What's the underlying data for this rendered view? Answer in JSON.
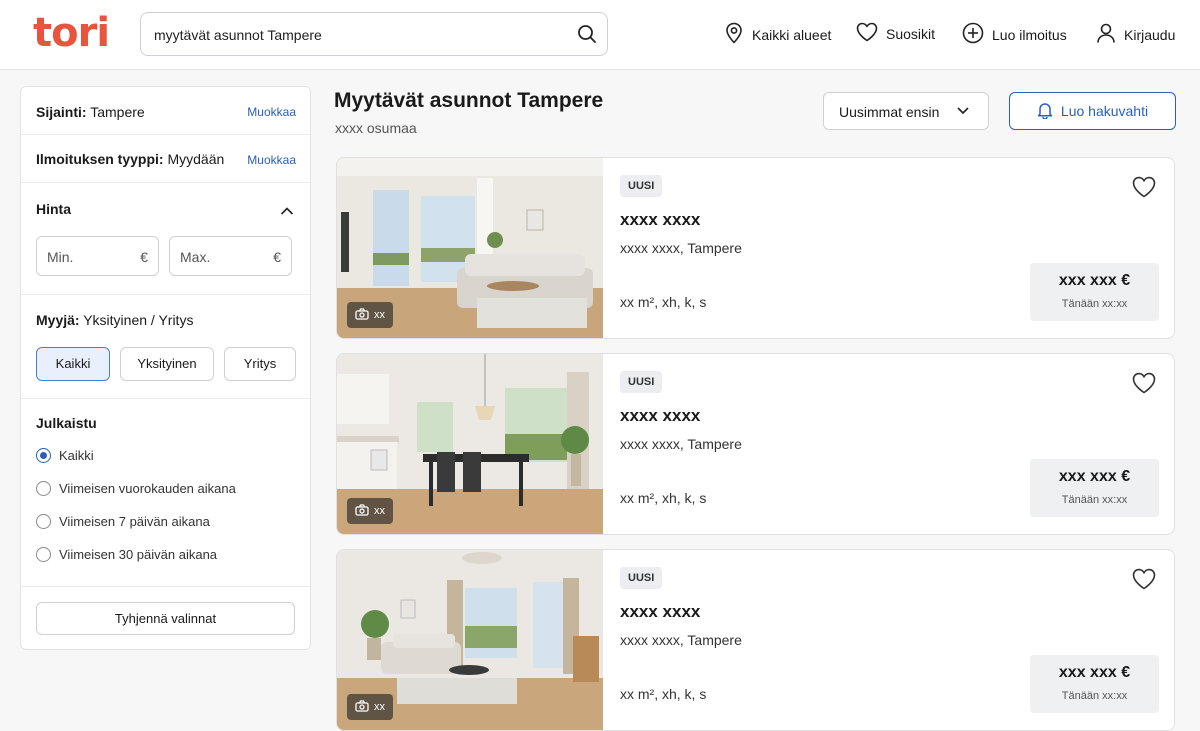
{
  "header": {
    "logo": "tori",
    "search_value": "myytävät asunnot Tampere",
    "nav": [
      {
        "label": "Kaikki alueet",
        "icon": "location-pin-icon"
      },
      {
        "label": "Suosikit",
        "icon": "heart-icon"
      },
      {
        "label": "Luo ilmoitus",
        "icon": "plus-circle-icon"
      },
      {
        "label": "Kirjaudu",
        "icon": "user-icon"
      }
    ]
  },
  "sidebar": {
    "location": {
      "label": "Sijainti:",
      "value": "Tampere",
      "edit": "Muokkaa"
    },
    "type": {
      "label": "Ilmoituksen tyyppi:",
      "value": "Myydään",
      "edit": "Muokkaa"
    },
    "price": {
      "label": "Hinta",
      "min_placeholder": "Min.",
      "max_placeholder": "Max.",
      "currency": "€"
    },
    "seller": {
      "label": "Myyjä:",
      "value": "Yksityinen / Yritys",
      "options": [
        "Kaikki",
        "Yksityinen",
        "Yritys"
      ],
      "selected": "Kaikki"
    },
    "published": {
      "label": "Julkaistu",
      "options": [
        "Kaikki",
        "Viimeisen vuorokauden aikana",
        "Viimeisen 7 päivän aikana",
        "Viimeisen 30 päivän aikana"
      ],
      "selected": "Kaikki"
    },
    "clear_button": "Tyhjennä valinnat"
  },
  "main": {
    "title": "Myytävät asunnot Tampere",
    "count": "xxxx osumaa",
    "sort_label": "Uusimmat ensin",
    "alert_button": "Luo hakuvahti",
    "listings": [
      {
        "badge": "UUSI",
        "title": "xxxx xxxx",
        "location": "xxxx xxxx, Tampere",
        "specs": "xx m², xh, k, s",
        "price": "xxx xxx €",
        "date": "Tänään xx:xx",
        "photos": "xx"
      },
      {
        "badge": "UUSI",
        "title": "xxxx xxxx",
        "location": "xxxx xxxx, Tampere",
        "specs": "xx m², xh, k, s",
        "price": "xxx xxx €",
        "date": "Tänään xx:xx",
        "photos": "xx"
      },
      {
        "badge": "UUSI",
        "title": "xxxx xxxx",
        "location": "xxxx xxxx, Tampere",
        "specs": "xx m², xh, k, s",
        "price": "xxx xxx €",
        "date": "Tänään xx:xx",
        "photos": "xx"
      }
    ]
  },
  "colors": {
    "brand": "#e8553c",
    "accent": "#2a5fb8"
  }
}
